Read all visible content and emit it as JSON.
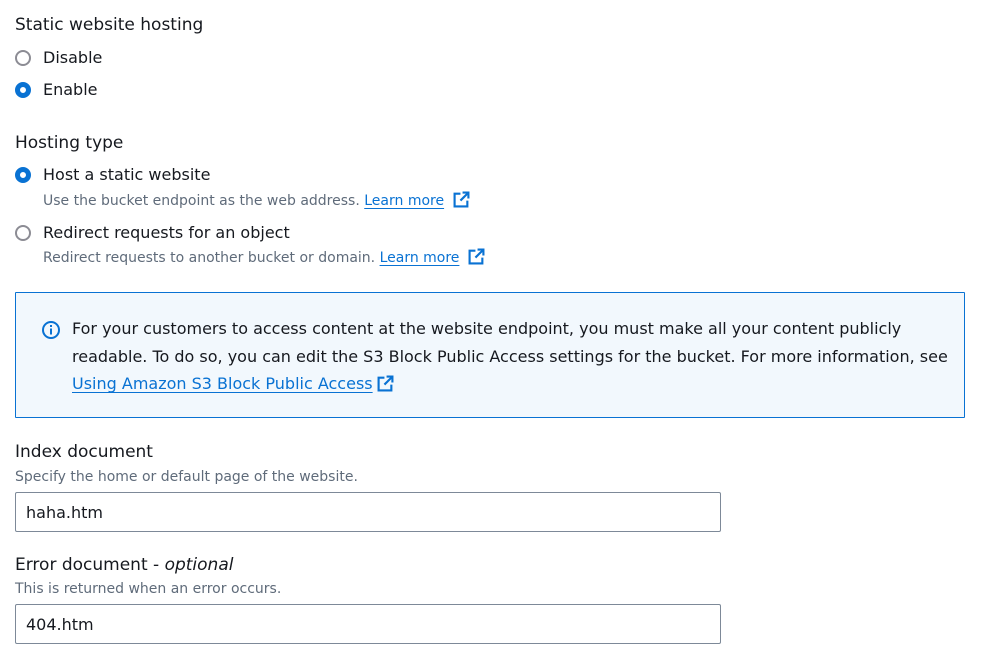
{
  "hosting": {
    "title": "Static website hosting",
    "options": [
      {
        "label": "Disable",
        "checked": false
      },
      {
        "label": "Enable",
        "checked": true
      }
    ]
  },
  "hosting_type": {
    "title": "Hosting type",
    "options": [
      {
        "label": "Host a static website",
        "checked": true,
        "description": "Use the bucket endpoint as the web address.",
        "link": "Learn more"
      },
      {
        "label": "Redirect requests for an object",
        "checked": false,
        "description": "Redirect requests to another bucket or domain.",
        "link": "Learn more"
      }
    ]
  },
  "info": {
    "text": "For your customers to access content at the website endpoint, you must make all your content publicly readable. To do so, you can edit the S3 Block Public Access settings for the bucket. For more information, see",
    "link": "Using Amazon S3 Block Public Access"
  },
  "index_document": {
    "label": "Index document",
    "description": "Specify the home or default page of the website.",
    "value": "haha.htm"
  },
  "error_document": {
    "label": "Error document - ",
    "label_optional": "optional",
    "description": "This is returned when an error occurs.",
    "value": "404.htm"
  },
  "colors": {
    "accent": "#0972d3",
    "info_bg": "#f2f8fd",
    "text": "#16191f",
    "secondary_text": "#5f6b7a"
  }
}
